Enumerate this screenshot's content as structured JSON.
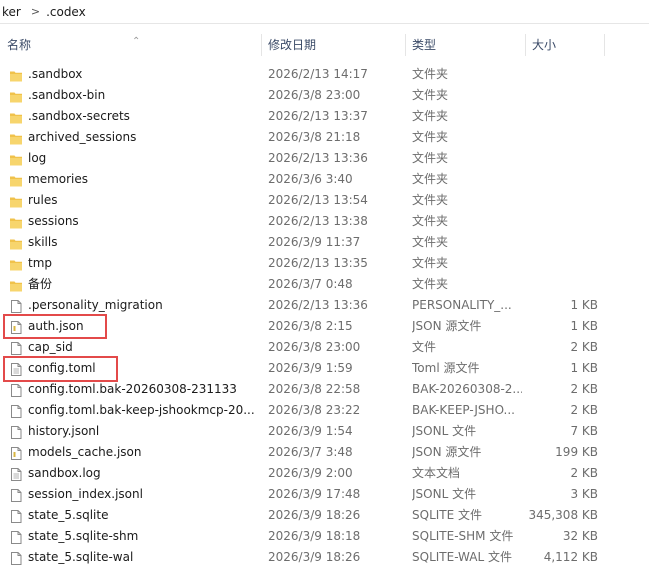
{
  "breadcrumb": {
    "parent": "ker",
    "current": ".codex"
  },
  "columns": {
    "name": "名称",
    "date": "修改日期",
    "type": "类型",
    "size": "大小"
  },
  "colors": {
    "folder": "#f0c24b",
    "highlight": "#e34a4a",
    "header_text": "#3a4a67"
  },
  "files": [
    {
      "name": ".sandbox",
      "date": "2026/2/13 14:17",
      "type": "文件夹",
      "size": "",
      "icon": "folder-icon"
    },
    {
      "name": ".sandbox-bin",
      "date": "2026/3/8 23:00",
      "type": "文件夹",
      "size": "",
      "icon": "folder-icon"
    },
    {
      "name": ".sandbox-secrets",
      "date": "2026/2/13 13:37",
      "type": "文件夹",
      "size": "",
      "icon": "folder-icon"
    },
    {
      "name": "archived_sessions",
      "date": "2026/3/8 21:18",
      "type": "文件夹",
      "size": "",
      "icon": "folder-icon"
    },
    {
      "name": "log",
      "date": "2026/2/13 13:36",
      "type": "文件夹",
      "size": "",
      "icon": "folder-icon"
    },
    {
      "name": "memories",
      "date": "2026/3/6 3:40",
      "type": "文件夹",
      "size": "",
      "icon": "folder-icon"
    },
    {
      "name": "rules",
      "date": "2026/2/13 13:54",
      "type": "文件夹",
      "size": "",
      "icon": "folder-icon"
    },
    {
      "name": "sessions",
      "date": "2026/2/13 13:38",
      "type": "文件夹",
      "size": "",
      "icon": "folder-icon"
    },
    {
      "name": "skills",
      "date": "2026/3/9 11:37",
      "type": "文件夹",
      "size": "",
      "icon": "folder-icon"
    },
    {
      "name": "tmp",
      "date": "2026/2/13 13:35",
      "type": "文件夹",
      "size": "",
      "icon": "folder-icon"
    },
    {
      "name": "备份",
      "date": "2026/3/7 0:48",
      "type": "文件夹",
      "size": "",
      "icon": "folder-icon"
    },
    {
      "name": ".personality_migration",
      "date": "2026/2/13 13:36",
      "type": "PERSONALITY_...",
      "size": "1 KB",
      "icon": "file-icon"
    },
    {
      "name": "auth.json",
      "date": "2026/3/8 2:15",
      "type": "JSON 源文件",
      "size": "1 KB",
      "icon": "json-file-icon"
    },
    {
      "name": "cap_sid",
      "date": "2026/3/8 23:00",
      "type": "文件",
      "size": "2 KB",
      "icon": "file-icon"
    },
    {
      "name": "config.toml",
      "date": "2026/3/9 1:59",
      "type": "Toml 源文件",
      "size": "1 KB",
      "icon": "text-file-icon"
    },
    {
      "name": "config.toml.bak-20260308-231133",
      "date": "2026/3/8 22:58",
      "type": "BAK-20260308-2...",
      "size": "2 KB",
      "icon": "file-icon"
    },
    {
      "name": "config.toml.bak-keep-jshookmcp-20...",
      "date": "2026/3/8 23:22",
      "type": "BAK-KEEP-JSHO...",
      "size": "2 KB",
      "icon": "file-icon"
    },
    {
      "name": "history.jsonl",
      "date": "2026/3/9 1:54",
      "type": "JSONL 文件",
      "size": "7 KB",
      "icon": "file-icon"
    },
    {
      "name": "models_cache.json",
      "date": "2026/3/7 3:48",
      "type": "JSON 源文件",
      "size": "199 KB",
      "icon": "json-file-icon"
    },
    {
      "name": "sandbox.log",
      "date": "2026/3/9 2:00",
      "type": "文本文档",
      "size": "2 KB",
      "icon": "text-file-icon"
    },
    {
      "name": "session_index.jsonl",
      "date": "2026/3/9 17:48",
      "type": "JSONL 文件",
      "size": "3 KB",
      "icon": "file-icon"
    },
    {
      "name": "state_5.sqlite",
      "date": "2026/3/9 18:26",
      "type": "SQLITE 文件",
      "size": "345,308 KB",
      "icon": "file-icon"
    },
    {
      "name": "state_5.sqlite-shm",
      "date": "2026/3/9 18:18",
      "type": "SQLITE-SHM 文件",
      "size": "32 KB",
      "icon": "file-icon"
    },
    {
      "name": "state_5.sqlite-wal",
      "date": "2026/3/9 18:26",
      "type": "SQLITE-WAL 文件",
      "size": "4,112 KB",
      "icon": "file-icon"
    }
  ]
}
